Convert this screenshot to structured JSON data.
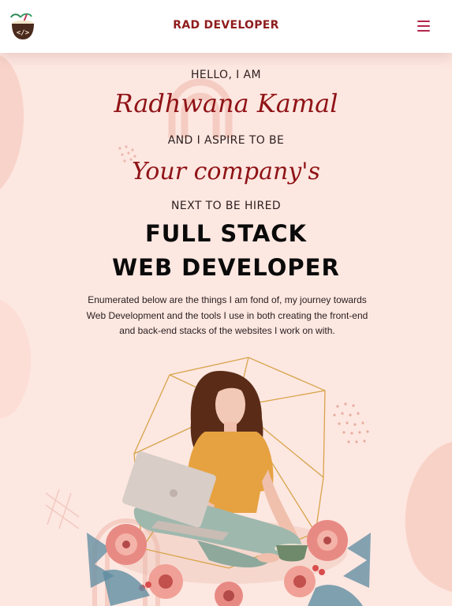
{
  "header": {
    "brand": "RAD DEVELOPER",
    "logo_icon": "coconut-code-logo-icon",
    "menu_icon": "hamburger-menu-icon"
  },
  "hero": {
    "greeting": "HELLO, I AM",
    "name": "Radhwana Kamal",
    "aspire": "AND I ASPIRE TO BE",
    "company": "Your company's",
    "next": "NEXT TO BE HIRED",
    "role_line1": "FULL STACK",
    "role_line2": "WEB DEVELOPER",
    "description": "Enumerated below are the things I am fond of, my journey towards Web Development and the tools I use in both creating the front-end and back-end stacks of the websites I work on with."
  },
  "illustration": {
    "name": "girl-with-laptop-illustration"
  },
  "colors": {
    "background": "#fde7e1",
    "brand": "#8f1d1d",
    "script": "#8f1316",
    "menu": "#b3254a",
    "heading": "#0a0a0a"
  }
}
